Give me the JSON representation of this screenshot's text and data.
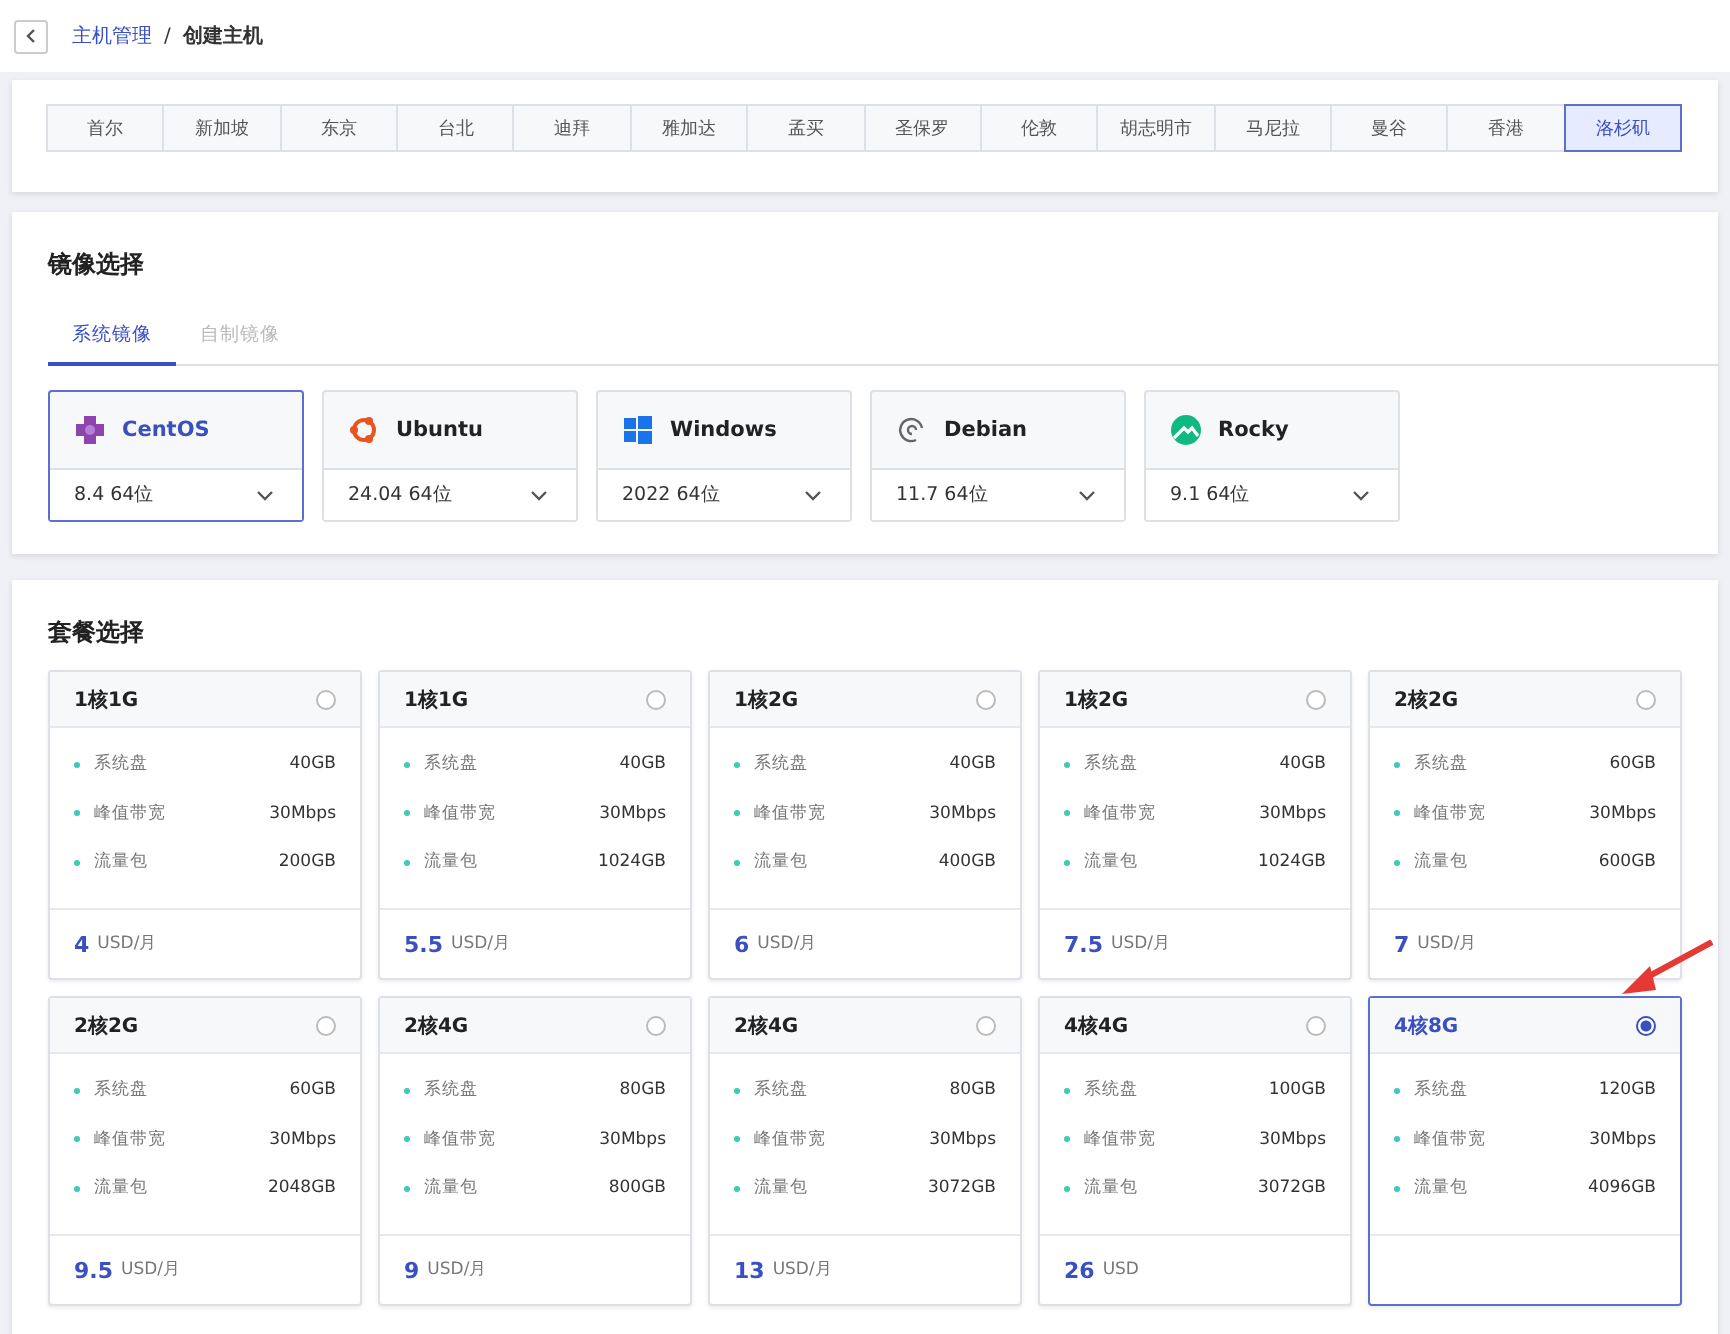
{
  "breadcrumb": {
    "parent": "主机管理",
    "separator": "/",
    "current": "创建主机"
  },
  "regions": [
    {
      "label": "首尔",
      "selected": false
    },
    {
      "label": "新加坡",
      "selected": false
    },
    {
      "label": "东京",
      "selected": false
    },
    {
      "label": "台北",
      "selected": false
    },
    {
      "label": "迪拜",
      "selected": false
    },
    {
      "label": "雅加达",
      "selected": false
    },
    {
      "label": "孟买",
      "selected": false
    },
    {
      "label": "圣保罗",
      "selected": false
    },
    {
      "label": "伦敦",
      "selected": false
    },
    {
      "label": "胡志明市",
      "selected": false
    },
    {
      "label": "马尼拉",
      "selected": false
    },
    {
      "label": "曼谷",
      "selected": false
    },
    {
      "label": "香港",
      "selected": false
    },
    {
      "label": "洛杉矶",
      "selected": true
    }
  ],
  "image_section": {
    "title": "镜像选择",
    "tabs": [
      {
        "label": "系统镜像",
        "selected": true
      },
      {
        "label": "自制镜像",
        "selected": false
      }
    ],
    "images": [
      {
        "kind": "centos",
        "name": "CentOS",
        "version": "8.4 64位",
        "selected": true
      },
      {
        "kind": "ubuntu",
        "name": "Ubuntu",
        "version": "24.04 64位",
        "selected": false
      },
      {
        "kind": "windows",
        "name": "Windows",
        "version": "2022 64位",
        "selected": false
      },
      {
        "kind": "debian",
        "name": "Debian",
        "version": "11.7 64位",
        "selected": false
      },
      {
        "kind": "rocky",
        "name": "Rocky",
        "version": "9.1 64位",
        "selected": false
      }
    ]
  },
  "plan_section": {
    "title": "套餐选择",
    "plans": [
      {
        "name": "1核1G",
        "specs": [
          [
            "系统盘",
            "40GB"
          ],
          [
            "峰值带宽",
            "30Mbps"
          ],
          [
            "流量包",
            "200GB"
          ]
        ],
        "price": "4",
        "unit": "USD/月",
        "selected": false
      },
      {
        "name": "1核1G",
        "specs": [
          [
            "系统盘",
            "40GB"
          ],
          [
            "峰值带宽",
            "30Mbps"
          ],
          [
            "流量包",
            "1024GB"
          ]
        ],
        "price": "5.5",
        "unit": "USD/月",
        "selected": false
      },
      {
        "name": "1核2G",
        "specs": [
          [
            "系统盘",
            "40GB"
          ],
          [
            "峰值带宽",
            "30Mbps"
          ],
          [
            "流量包",
            "400GB"
          ]
        ],
        "price": "6",
        "unit": "USD/月",
        "selected": false
      },
      {
        "name": "1核2G",
        "specs": [
          [
            "系统盘",
            "40GB"
          ],
          [
            "峰值带宽",
            "30Mbps"
          ],
          [
            "流量包",
            "1024GB"
          ]
        ],
        "price": "7.5",
        "unit": "USD/月",
        "selected": false
      },
      {
        "name": "2核2G",
        "specs": [
          [
            "系统盘",
            "60GB"
          ],
          [
            "峰值带宽",
            "30Mbps"
          ],
          [
            "流量包",
            "600GB"
          ]
        ],
        "price": "7",
        "unit": "USD/月",
        "selected": false
      },
      {
        "name": "2核2G",
        "specs": [
          [
            "系统盘",
            "60GB"
          ],
          [
            "峰值带宽",
            "30Mbps"
          ],
          [
            "流量包",
            "2048GB"
          ]
        ],
        "price": "9.5",
        "unit": "USD/月",
        "selected": false
      },
      {
        "name": "2核4G",
        "specs": [
          [
            "系统盘",
            "80GB"
          ],
          [
            "峰值带宽",
            "30Mbps"
          ],
          [
            "流量包",
            "800GB"
          ]
        ],
        "price": "9",
        "unit": "USD/月",
        "selected": false
      },
      {
        "name": "2核4G",
        "specs": [
          [
            "系统盘",
            "80GB"
          ],
          [
            "峰值带宽",
            "30Mbps"
          ],
          [
            "流量包",
            "3072GB"
          ]
        ],
        "price": "13",
        "unit": "USD/月",
        "selected": false
      },
      {
        "name": "4核4G",
        "specs": [
          [
            "系统盘",
            "100GB"
          ],
          [
            "峰值带宽",
            "30Mbps"
          ],
          [
            "流量包",
            "3072GB"
          ]
        ],
        "price": "26",
        "unit": "USD",
        "selected": false
      },
      {
        "name": "4核8G",
        "specs": [
          [
            "系统盘",
            "120GB"
          ],
          [
            "峰值带宽",
            "30Mbps"
          ],
          [
            "流量包",
            "4096GB"
          ]
        ],
        "selected": true
      }
    ]
  }
}
